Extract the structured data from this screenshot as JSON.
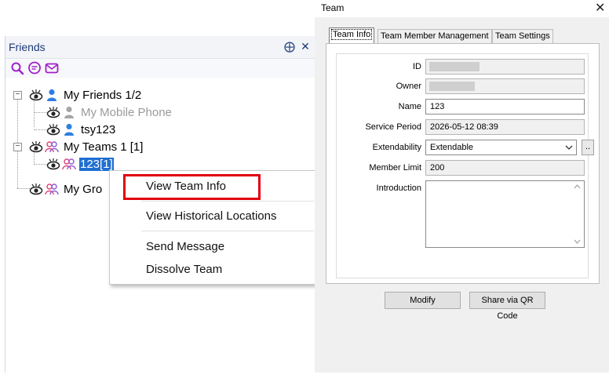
{
  "friends_panel": {
    "title": "Friends",
    "pin_glyph": "⨁",
    "close_glyph": "✕",
    "toolbar": [
      {
        "icon": "search-icon"
      },
      {
        "icon": "chat-icon"
      },
      {
        "icon": "mail-icon"
      }
    ],
    "tree": {
      "my_friends": "My Friends 1/2",
      "my_mobile_phone": "My Mobile Phone",
      "tsy123": "tsy123",
      "my_teams": "My Teams 1 [1]",
      "team_123": "123[1]",
      "my_groups": "My Gro"
    }
  },
  "context_menu": {
    "items": [
      "View Team Info",
      "View Historical Locations",
      "Send Message",
      "Dissolve Team"
    ],
    "highlight_color": "#e3000f"
  },
  "dialog": {
    "title": "Team",
    "close_glyph": "✕",
    "tabs": [
      "Team Info",
      "Team Member Management",
      "Team Settings"
    ],
    "fields": {
      "id_label": "ID",
      "owner_label": "Owner",
      "name_label": "Name",
      "name_value": "123",
      "service_period_label": "Service Period",
      "service_period_value": "2026-05-12 08:39",
      "extendability_label": "Extendability",
      "extendability_value": "Extendable",
      "extend_button": "..",
      "member_limit_label": "Member Limit",
      "member_limit_value": "200",
      "introduction_label": "Introduction"
    },
    "buttons": {
      "modify": "Modify",
      "share_qr": "Share via QR Code"
    }
  },
  "colors": {
    "accent": "#1e3c78",
    "selection": "#1f6fd1",
    "icon_purple": "#a020c8"
  }
}
